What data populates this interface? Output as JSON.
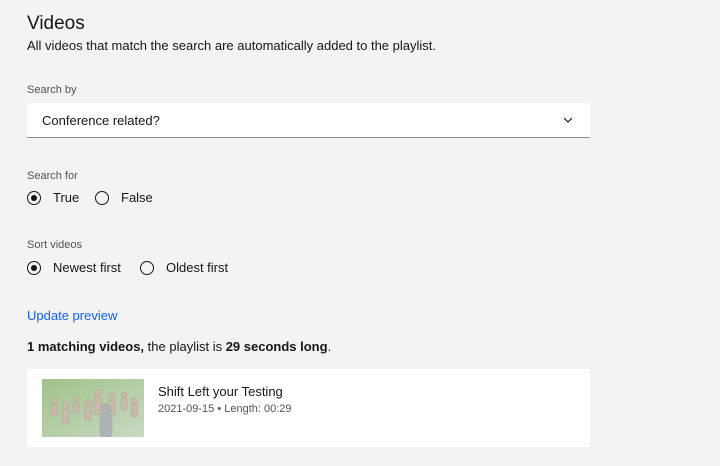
{
  "header": {
    "title": "Videos",
    "subtitle": "All videos that match the search are automatically added to the playlist."
  },
  "search_by": {
    "label": "Search by",
    "selected": "Conference related?",
    "icon": "chevron-down-icon"
  },
  "search_for": {
    "label": "Search for",
    "options": [
      {
        "label": "True",
        "checked": true
      },
      {
        "label": "False",
        "checked": false
      }
    ]
  },
  "sort_videos": {
    "label": "Sort videos",
    "options": [
      {
        "label": "Newest first",
        "checked": true
      },
      {
        "label": "Oldest first",
        "checked": false
      }
    ]
  },
  "update_preview": "Update preview",
  "summary": {
    "count_text": "1 matching videos,",
    "middle_text": " the playlist is ",
    "length_text": "29 seconds long",
    "end_text": "."
  },
  "videos": [
    {
      "title": "Shift Left your Testing",
      "meta": "2021-09-15 • Length: 00:29"
    }
  ],
  "colors": {
    "background": "#f3f3f3",
    "link": "#0f62fe",
    "text": "#161616",
    "muted": "#525252"
  }
}
